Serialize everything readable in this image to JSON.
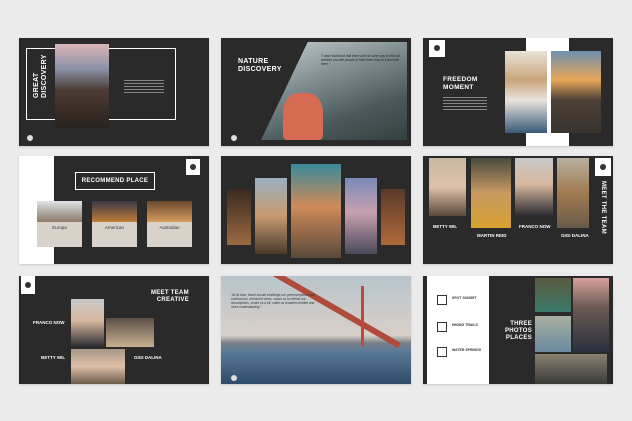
{
  "slides": [
    {
      "title_line1": "GREAT",
      "title_line2": "DISCOVERY"
    },
    {
      "title_line1": "NATURE",
      "title_line2": "DISCOVERY",
      "quote": "\"I have found out that there ain't no surer way to find out whether you like people or hate them than to travel with them.\""
    },
    {
      "title_line1": "FREEDOM",
      "title_line2": "MOMENT"
    },
    {
      "title": "RECOMMEND PLACE",
      "places": [
        "Europa",
        "American",
        "Australian"
      ]
    },
    {
      "title": "Photo gallery"
    },
    {
      "title": "MEET THE TEAM",
      "members": [
        "BETTY WIL",
        "MARTIN REID",
        "FRANCO NOW",
        "GIGI DALINA"
      ]
    },
    {
      "title_line1": "MEET TEAM",
      "title_line2": "CREATIVE",
      "members": [
        "FRANCO NOW",
        "BETTY WIL",
        "GIGI DALINA"
      ]
    },
    {
      "quote": "\"At its best, travel should challenge our preconceptions and confront our cherished views, cause us to rethink our assumptions, shake us a bit, make us broaden minded and more understanding.\""
    },
    {
      "title_line1": "THREE",
      "title_line2": "PHOTOS",
      "title_line3": "PLACES",
      "items": [
        "SPOT SUNSET",
        "HIKING TRAILS",
        "WATER SPRINGS"
      ]
    }
  ]
}
